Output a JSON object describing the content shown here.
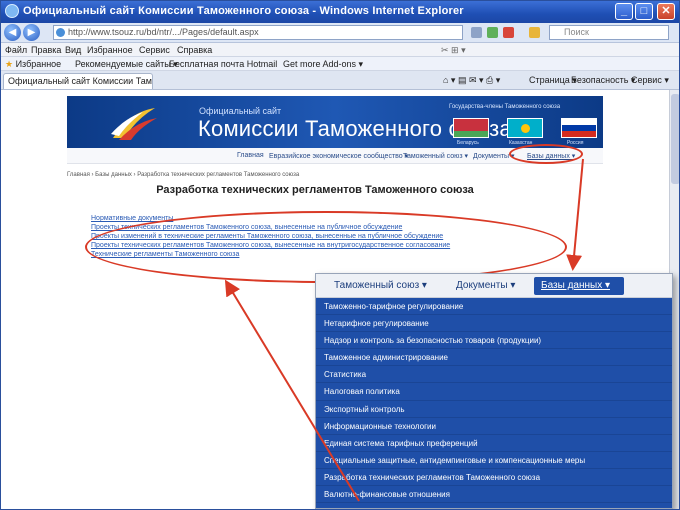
{
  "browser": {
    "window_title": "Официальный сайт Комиссии Таможенного союза - Windows Internet Explorer",
    "address_url": "http://www.tsouz.ru/bd/ntr/.../Pages/default.aspx",
    "search_placeholder": "Поиск",
    "menu": [
      "Файл",
      "Правка",
      "Вид",
      "Избранное",
      "Сервис",
      "Справка"
    ],
    "favorites_label": "Избранное",
    "favorites_items": [
      "Рекомендуемые сайты ▾",
      "Бесплатная почта Hotmail",
      "Get more Add-ons ▾"
    ],
    "tab_title": "Официальный сайт Комиссии Таможенного...",
    "toolbar_tools": [
      "Страница ▾",
      "Безопасность ▾",
      "Сервис ▾"
    ]
  },
  "site": {
    "subtitle": "Официальный сайт",
    "title": "Комиссии Таможенного союза",
    "flags_caption": "Государства-члены Таможенного союза",
    "flag_labels": [
      "Беларусь",
      "Казахстан",
      "Россия"
    ],
    "nav": [
      "Главная",
      "Евразийское экономическое сообщество ▾",
      "Таможенный союз ▾",
      "Документы ▾",
      "Базы данных ▾"
    ],
    "breadcrumb": "Главная › Базы данных › Разработка технических регламентов Таможенного союза",
    "heading": "Разработка технических регламентов Таможенного союза",
    "links": [
      "Нормативные документы",
      "Проекты технических регламентов Таможенного союза, вынесенные на публичное обсуждение",
      "Проекты изменений в технические регламенты Таможенного союза, вынесенные на публичное обсуждение",
      "Проекты технических регламентов Таможенного союза, вынесенные на внутригосударственное согласование",
      "Технические регламенты Таможенного союза"
    ]
  },
  "inset": {
    "nav_items": [
      "Таможенный союз ▾",
      "Документы ▾"
    ],
    "dropdown_label": "Базы данных ▾",
    "menu_items": [
      "Таможенно-тарифное регулирование",
      "Нетарифное регулирование",
      "Надзор и контроль за безопасностью товаров (продукции)",
      "Таможенное администрирование",
      "Статистика",
      "Налоговая политика",
      "Экспортный контроль",
      "Информационные технологии",
      "Единая система тарифных преференций",
      "Специальные защитные, антидемпинговые и компенсационные меры",
      "Разработка технических регламентов Таможенного союза",
      "Валютно-финансовые отношения"
    ]
  },
  "colors": {
    "annotation_red": "#d93a26",
    "brand_blue": "#1f4fa8",
    "link_blue": "#2a5bb5"
  }
}
